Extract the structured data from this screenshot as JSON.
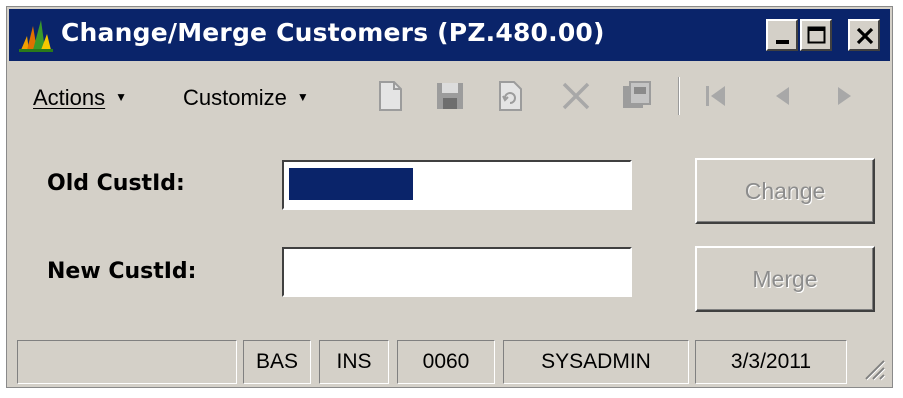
{
  "window": {
    "title": "Change/Merge Customers (PZ.480.00)",
    "buttons": [
      "minimize",
      "maximize",
      "close"
    ],
    "title_bar_color": "#0a246a",
    "face_color": "#d4d0c8"
  },
  "menu": {
    "actions": "Actions",
    "customize": "Customize"
  },
  "toolbar": {
    "icons": [
      "new-icon",
      "save-icon",
      "refresh-icon",
      "delete-icon",
      "copy-icon",
      "first-record-icon",
      "previous-record-icon",
      "next-record-icon"
    ]
  },
  "form": {
    "old_label": "Old CustId:",
    "old_value": "",
    "new_label": "New CustId:",
    "new_value": "",
    "change_button": "Change",
    "merge_button": "Merge"
  },
  "status": {
    "cells": [
      "",
      "BAS",
      "INS",
      "0060",
      "SYSADMIN",
      "3/3/2011"
    ]
  }
}
